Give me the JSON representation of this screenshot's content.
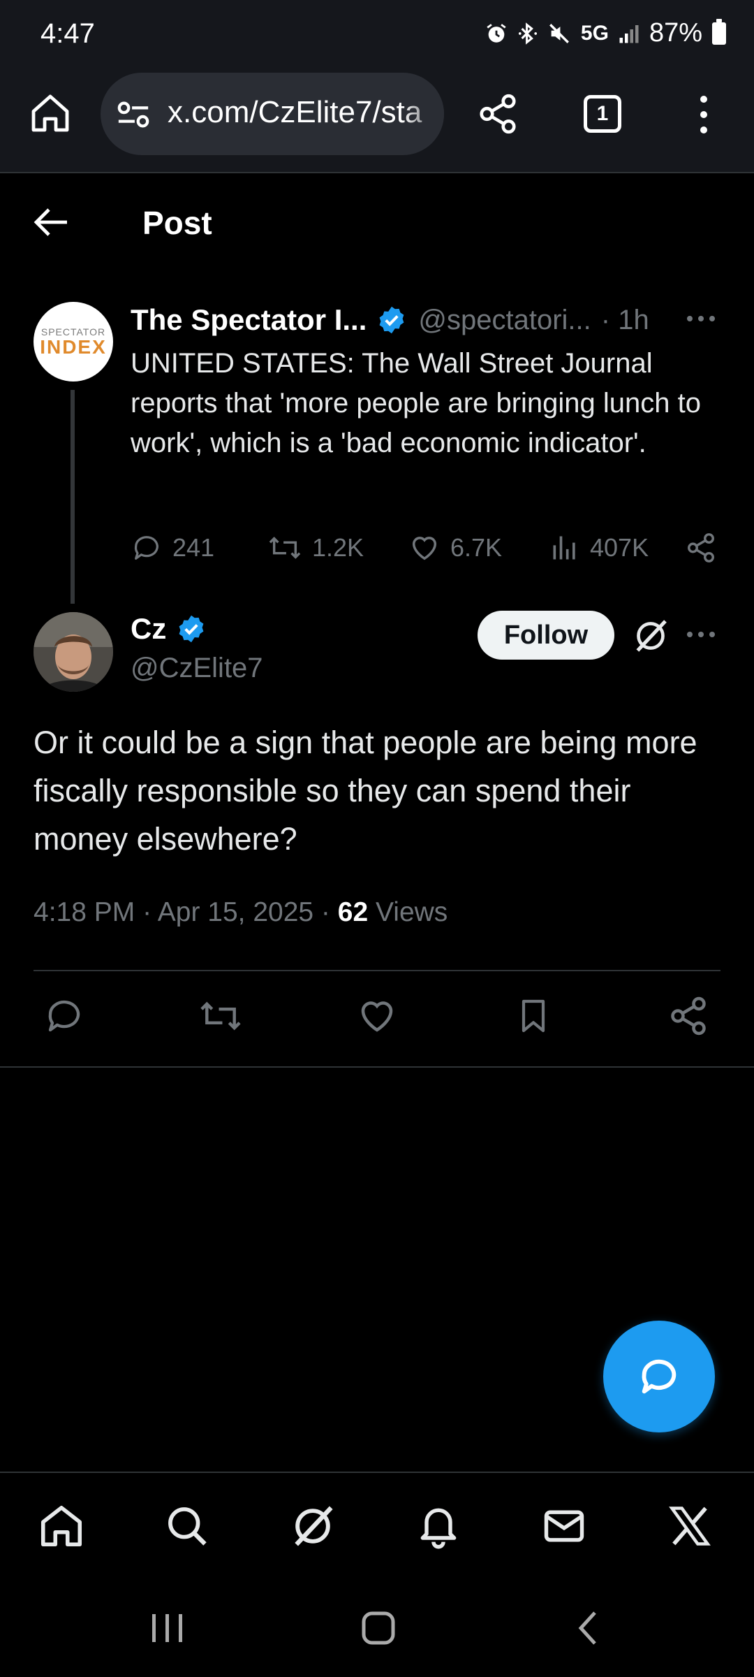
{
  "status_bar": {
    "time": "4:47",
    "network": "5G",
    "battery": "87%"
  },
  "browser": {
    "url": "x.com/CzElite7/sta",
    "tab_count": "1"
  },
  "header": {
    "title": "Post"
  },
  "parent_tweet": {
    "avatar_text_small": "SPECTATOR",
    "avatar_text_big": "INDEX",
    "name": "The Spectator I...",
    "handle": "@spectatori...",
    "time": "· 1h",
    "text": "UNITED STATES: The Wall Street Journal reports that 'more people are bringing lunch to work', which is a 'bad economic indicator'.",
    "replies": "241",
    "reposts": "1.2K",
    "likes": "6.7K",
    "views": "407K"
  },
  "main_tweet": {
    "name": "Cz",
    "handle": "@CzElite7",
    "follow_label": "Follow",
    "text": "Or it could be a sign that people are being more fiscally responsible so they can spend their money elsewhere?",
    "timestamp": "4:18 PM · Apr 15, 2025 · ",
    "views_count": "62",
    "views_label": " Views"
  },
  "colors": {
    "accent": "#1d9bf0",
    "background": "#000000",
    "secondary_text": "#71767b"
  },
  "icons": {
    "nav": [
      "home-icon",
      "search-icon",
      "grok-icon",
      "notifications-icon",
      "messages-icon",
      "x-logo-icon"
    ]
  }
}
